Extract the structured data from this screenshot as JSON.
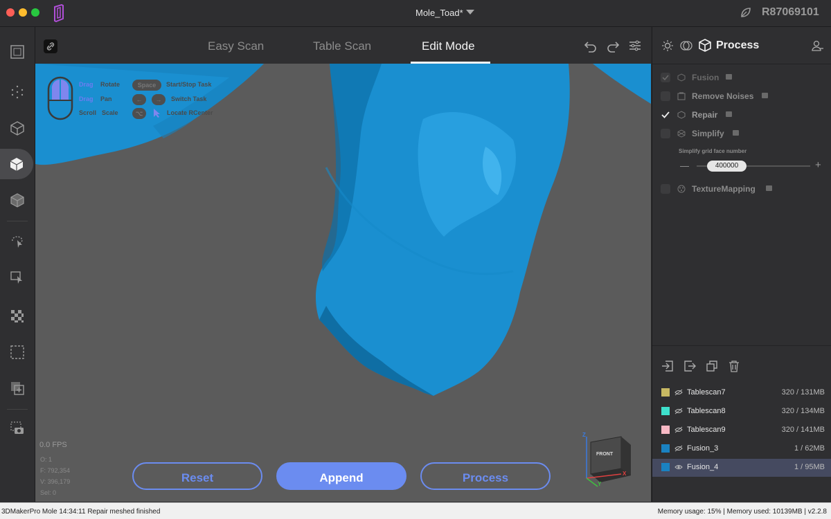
{
  "window": {
    "document_title": "Mole_Toad*",
    "license_code": "R87069101"
  },
  "tabs": [
    {
      "label": "Easy Scan",
      "active": false
    },
    {
      "label": "Table Scan",
      "active": false
    },
    {
      "label": "Edit Mode",
      "active": true
    }
  ],
  "viewport": {
    "hints": {
      "drag1": "Drag",
      "rotate": "Rotate",
      "space_key": "Space",
      "start_stop": "Start/Stop Task",
      "drag2": "Drag",
      "pan": "Pan",
      "switch_task": "Switch Task",
      "scroll": "Scroll",
      "scale": "Scale",
      "opt_key": "⌥",
      "locate": "Locate RCenter"
    },
    "fps": "0.0 FPS",
    "stats": [
      "O: 1",
      "F: 792,354",
      "V: 396,179",
      "Sel: 0"
    ],
    "buttons": {
      "reset": "Reset",
      "append": "Append",
      "process": "Process"
    },
    "cube_label": "FRONT",
    "axis_z": "Z",
    "axis_x": "X",
    "axis_y": "Y"
  },
  "panel": {
    "title": "Process",
    "steps": [
      {
        "label": "Fusion",
        "checked": true,
        "enabled": false
      },
      {
        "label": "Remove Noises",
        "checked": false,
        "enabled": true
      },
      {
        "label": "Repair",
        "checked": true,
        "enabled": true
      },
      {
        "label": "Simplify",
        "checked": false,
        "enabled": true
      },
      {
        "label": "TextureMapping",
        "checked": false,
        "enabled": true
      }
    ],
    "simplify_label": "Simplify grid face number",
    "simplify_value": "400000",
    "minus": "—",
    "plus": "+",
    "scans": [
      {
        "name": "Tablescan7",
        "size": "320 / 131MB",
        "color": "#c8b963",
        "visible": false,
        "selected": false
      },
      {
        "name": "Tablescan8",
        "size": "320 / 134MB",
        "color": "#3ee0cc",
        "visible": false,
        "selected": false
      },
      {
        "name": "Tablescan9",
        "size": "320 / 141MB",
        "color": "#f7b8c4",
        "visible": false,
        "selected": false
      },
      {
        "name": "Fusion_3",
        "size": "1 / 62MB",
        "color": "#1a82c2",
        "visible": false,
        "selected": false
      },
      {
        "name": "Fusion_4",
        "size": "1 / 95MB",
        "color": "#1a82c2",
        "visible": true,
        "selected": true
      }
    ]
  },
  "status": {
    "left": "3DMakerPro Mole   14:34:11 Repair meshed finished",
    "right": "Memory usage: 15% | Memory used: 10139MB | v2.2.8"
  },
  "colors": {
    "accent": "#6b8cf0",
    "mesh": "#1a8fd0",
    "viewport_bg": "#5b5b5b"
  }
}
